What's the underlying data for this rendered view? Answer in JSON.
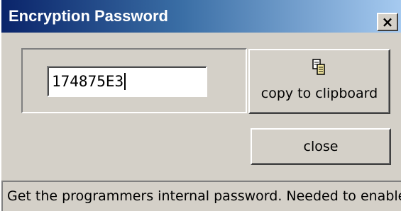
{
  "window": {
    "title": "Encryption Password",
    "close_glyph": "×"
  },
  "password": {
    "value": "174875E3"
  },
  "buttons": {
    "copy_icon": "clipboard-copy-icon",
    "copy_label": "copy to clipboard",
    "close_label": "close"
  },
  "status": {
    "text": "Get the programmers internal password. Needed to enable"
  },
  "colors": {
    "titlebar_start": "#0a246a",
    "titlebar_end": "#a6caf0",
    "face": "#d4d0c8"
  }
}
